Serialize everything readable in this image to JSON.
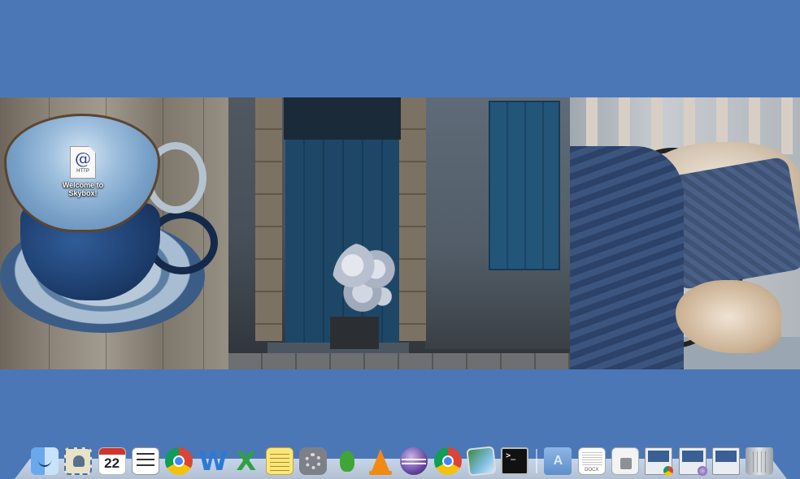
{
  "desktop": {
    "background_color": "#4b77b7",
    "icons": [
      {
        "icon_label": "HTTP",
        "symbol": "@",
        "label": "Welcome to Skybox!"
      }
    ]
  },
  "dock": {
    "items": [
      {
        "name": "finder-icon",
        "app": "Finder"
      },
      {
        "name": "mail-icon",
        "app": "Mail"
      },
      {
        "name": "calendar-icon",
        "app": "Calendar",
        "date_number": "22"
      },
      {
        "name": "reminders-icon",
        "app": "Reminders"
      },
      {
        "name": "chrome-icon",
        "app": "Google Chrome"
      },
      {
        "name": "word-icon",
        "app": "Word",
        "glyph": "W"
      },
      {
        "name": "excel-icon",
        "app": "Excel",
        "glyph": "X"
      },
      {
        "name": "stickies-icon",
        "app": "Stickies"
      },
      {
        "name": "system-preferences-icon",
        "app": "System Preferences"
      },
      {
        "name": "adium-icon",
        "app": "Adium"
      },
      {
        "name": "vlc-icon",
        "app": "VLC"
      },
      {
        "name": "eclipse-icon",
        "app": "Eclipse"
      },
      {
        "name": "chrome-icon",
        "app": "Google Chrome"
      },
      {
        "name": "preview-icon",
        "app": "Preview"
      },
      {
        "name": "terminal-icon",
        "app": "Terminal",
        "prompt": ">_"
      },
      {
        "name": "applications-folder-icon",
        "app": "Applications"
      },
      {
        "name": "docx-document-icon",
        "label": "DOCX"
      },
      {
        "name": "disk-image-icon",
        "label": ""
      },
      {
        "name": "screenshot-thumbnail-icon",
        "label": ""
      },
      {
        "name": "screenshot-thumbnail-icon",
        "label": ""
      },
      {
        "name": "screenshot-thumbnail-icon",
        "label": ""
      },
      {
        "name": "trash-icon",
        "app": "Trash"
      }
    ]
  },
  "colors": {
    "accent_red": "#d0342c",
    "chrome_red": "#db4437",
    "chrome_yellow": "#f4c20d",
    "chrome_green": "#0f9d58",
    "chrome_blue": "#4285f4",
    "word_blue": "#2b7bd6",
    "excel_green": "#2ea043"
  }
}
